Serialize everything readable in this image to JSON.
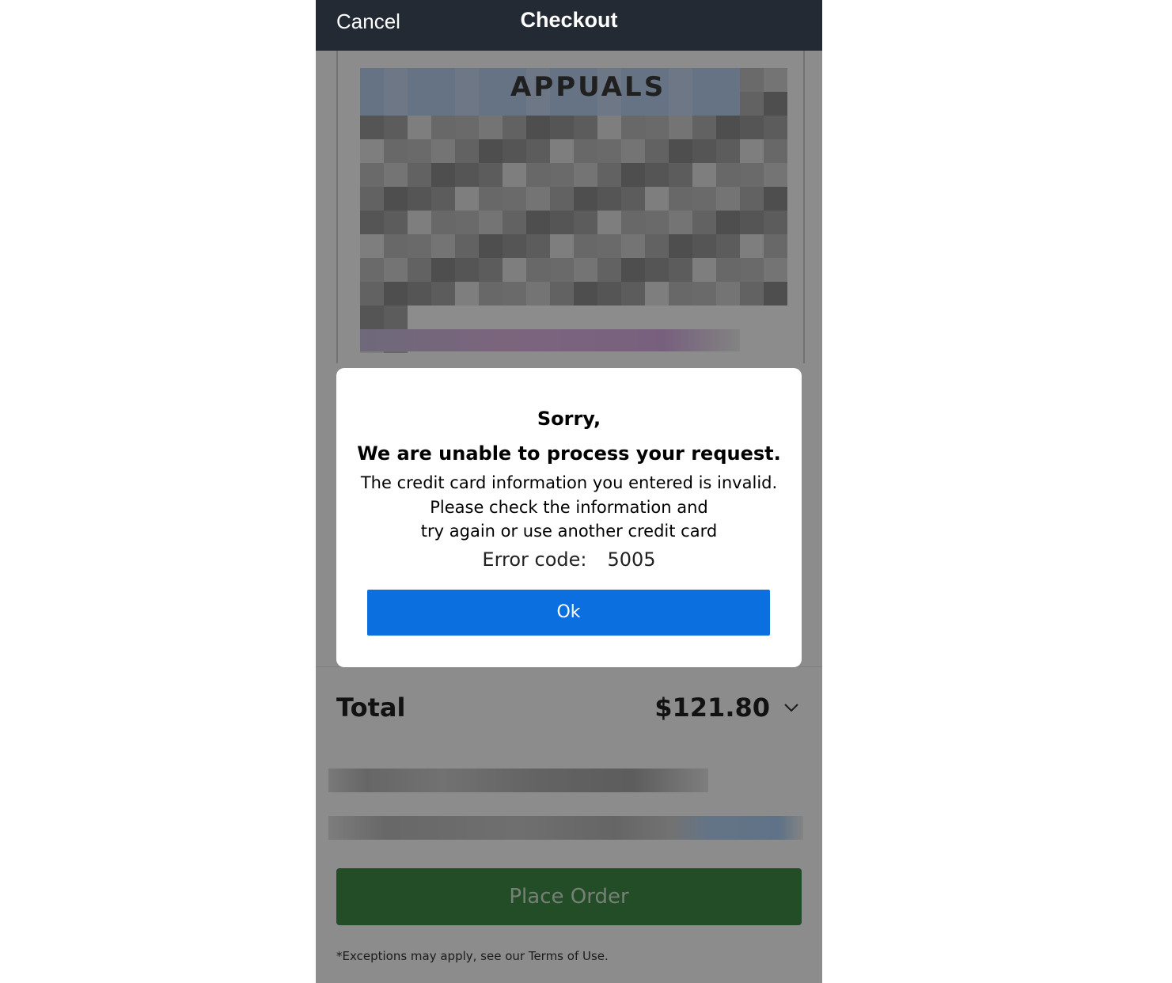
{
  "header": {
    "cancel_label": "Cancel",
    "title": "Checkout"
  },
  "watermark": {
    "text": "APPUALS"
  },
  "summary": {
    "total_label": "Total",
    "total_value": "$121.80",
    "chevron_icon": "chevron-down-icon",
    "place_order_label": "Place Order",
    "disclaimer": "*Exceptions may apply, see our Terms of Use."
  },
  "dialog": {
    "line_sorry": "Sorry,",
    "heading": "We are unable to process your request.",
    "message_line1": "The credit card information you entered is invalid.",
    "message_line2": "Please check the information and",
    "message_line3": "try again or use another credit card",
    "error_label": "Error code:",
    "error_code": "5005",
    "ok_label": "Ok"
  },
  "colors": {
    "navbar": "#232a33",
    "ok_button": "#0b6fe0",
    "place_order": "#3e8c45"
  }
}
